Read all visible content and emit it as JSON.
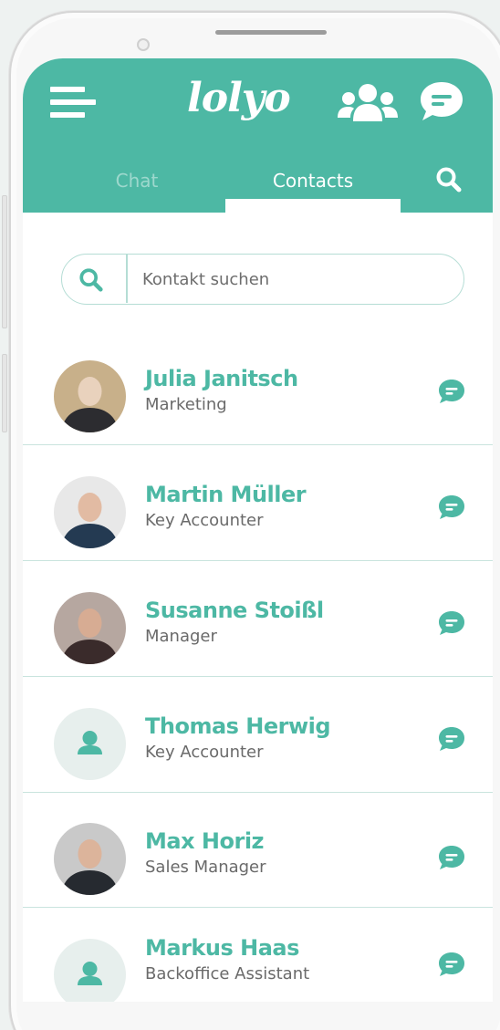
{
  "header": {
    "logo": "lolyo",
    "tabs": [
      {
        "label": "Chat",
        "active": false
      },
      {
        "label": "Contacts",
        "active": true
      }
    ]
  },
  "search": {
    "placeholder": "Kontakt suchen"
  },
  "contacts": [
    {
      "name": "Julia Janitsch",
      "role": "Marketing",
      "avatar": "photo"
    },
    {
      "name": "Martin Müller",
      "role": "Key Accounter",
      "avatar": "photo"
    },
    {
      "name": "Susanne Stoißl",
      "role": "Manager",
      "avatar": "photo"
    },
    {
      "name": "Thomas Herwig",
      "role": "Key Accounter",
      "avatar": "placeholder"
    },
    {
      "name": "Max Horiz",
      "role": "Sales Manager",
      "avatar": "photo"
    },
    {
      "name": "Markus Haas",
      "role": "Backoffice Assistant",
      "avatar": "placeholder"
    }
  ],
  "colors": {
    "accent": "#4db8a4",
    "background": "#ffffff",
    "divider": "#c9e4de"
  }
}
